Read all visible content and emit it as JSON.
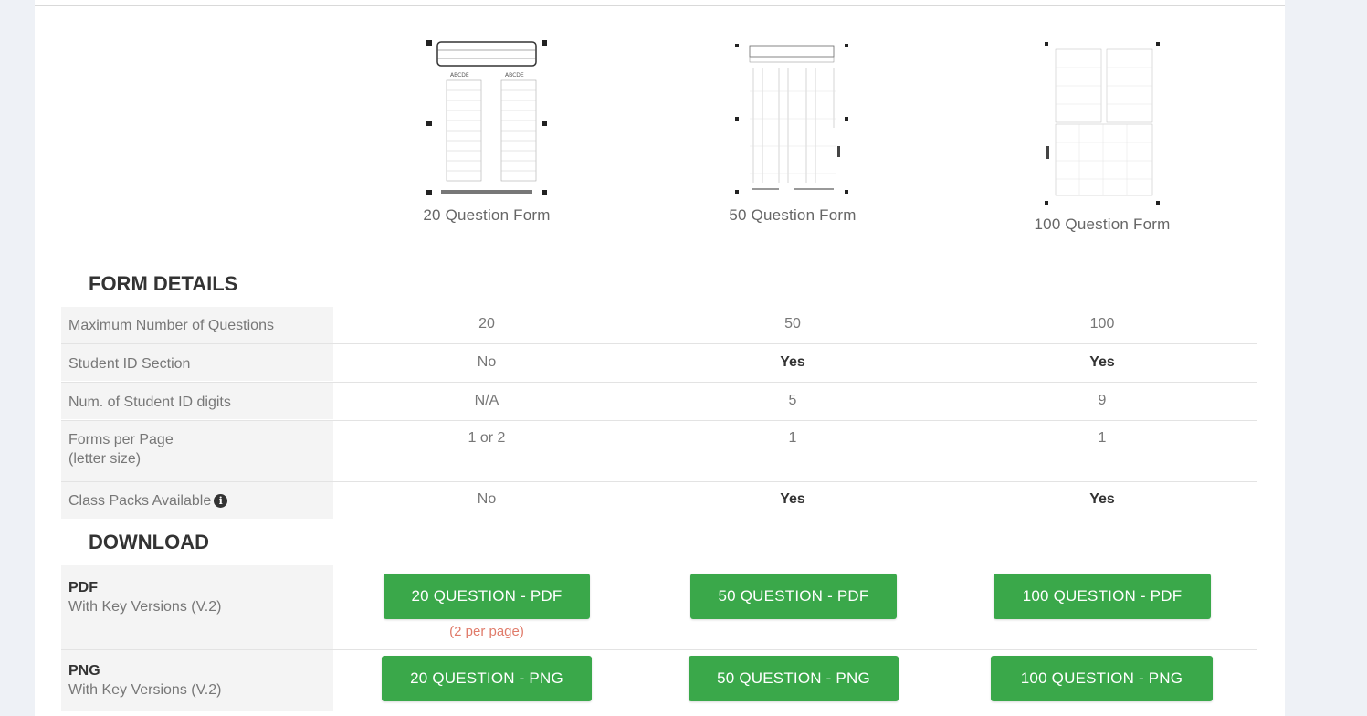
{
  "forms": [
    {
      "caption": "20 Question Form"
    },
    {
      "caption": "50 Question Form"
    },
    {
      "caption": "100 Question Form"
    }
  ],
  "form_details": {
    "title": "FORM DETAILS",
    "rows": [
      {
        "label": "Maximum Number of Questions",
        "sublabel": "",
        "values": [
          "20",
          "50",
          "100"
        ]
      },
      {
        "label": "Student ID Section",
        "sublabel": "",
        "values": [
          "No",
          "Yes",
          "Yes"
        ]
      },
      {
        "label": "Num. of Student ID digits",
        "sublabel": "",
        "values": [
          "N/A",
          "5",
          "9"
        ]
      },
      {
        "label": "Forms per Page",
        "sublabel": "(letter size)",
        "values": [
          "1 or 2",
          "1",
          "1"
        ]
      },
      {
        "label": "Class Packs Available",
        "sublabel": "",
        "values": [
          "No",
          "Yes",
          "Yes"
        ]
      }
    ]
  },
  "download": {
    "title": "DOWNLOAD",
    "pdf": {
      "label": "PDF",
      "sublabel": "With Key Versions (V.2)",
      "buttons": [
        "20 QUESTION - PDF",
        "50 QUESTION - PDF",
        "100 QUESTION - PDF"
      ],
      "note": "(2 per page)"
    },
    "png": {
      "label": "PNG",
      "sublabel": "With Key Versions (V.2)",
      "buttons": [
        "20 QUESTION - PNG",
        "50 QUESTION - PNG",
        "100 QUESTION - PNG"
      ]
    }
  },
  "colors": {
    "button": "#3aa84a",
    "note": "#e07b6a"
  },
  "icons": {
    "info": "info-circle-icon"
  }
}
